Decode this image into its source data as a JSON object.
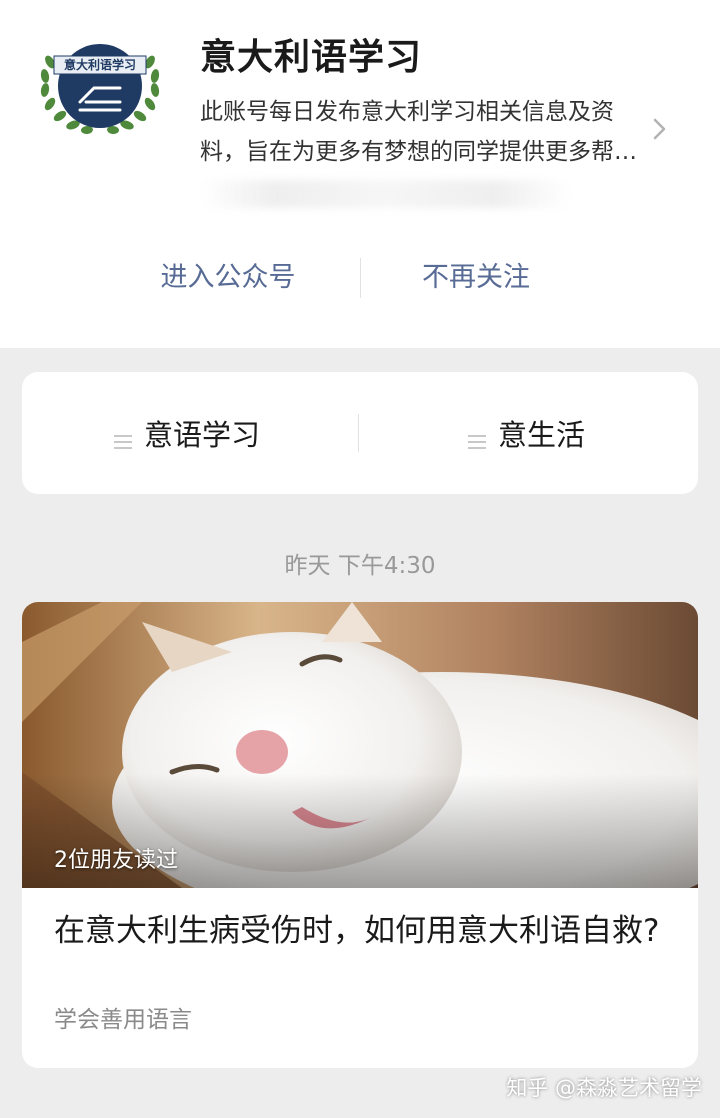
{
  "account": {
    "name": "意大利语学习",
    "logo_text": "意大利语学习",
    "description": "此账号每日发布意大利学习相关信息及资料，旨在为更多有梦想的同学提供更多帮助和资讯。",
    "actions": {
      "enter": "进入公众号",
      "unfollow": "不再关注"
    }
  },
  "menu": {
    "items": [
      {
        "label": "意语学习",
        "icon": "menu-lines-icon"
      },
      {
        "label": "意生活",
        "icon": "menu-lines-icon"
      }
    ]
  },
  "feed": {
    "timestamp": "昨天 下午4:30",
    "article": {
      "read_count": "2位朋友读过",
      "title": "在意大利生病受伤时，如何用意大利语自救?",
      "digest": "学会善用语言",
      "cover": "sleeping-white-cat-photo"
    }
  },
  "watermark": "知乎 @森淼艺术留学",
  "colors": {
    "link": "#576b95",
    "page_bg": "#ededed",
    "logo_navy": "#1f3a63",
    "laurel_green": "#4f8a3c"
  }
}
